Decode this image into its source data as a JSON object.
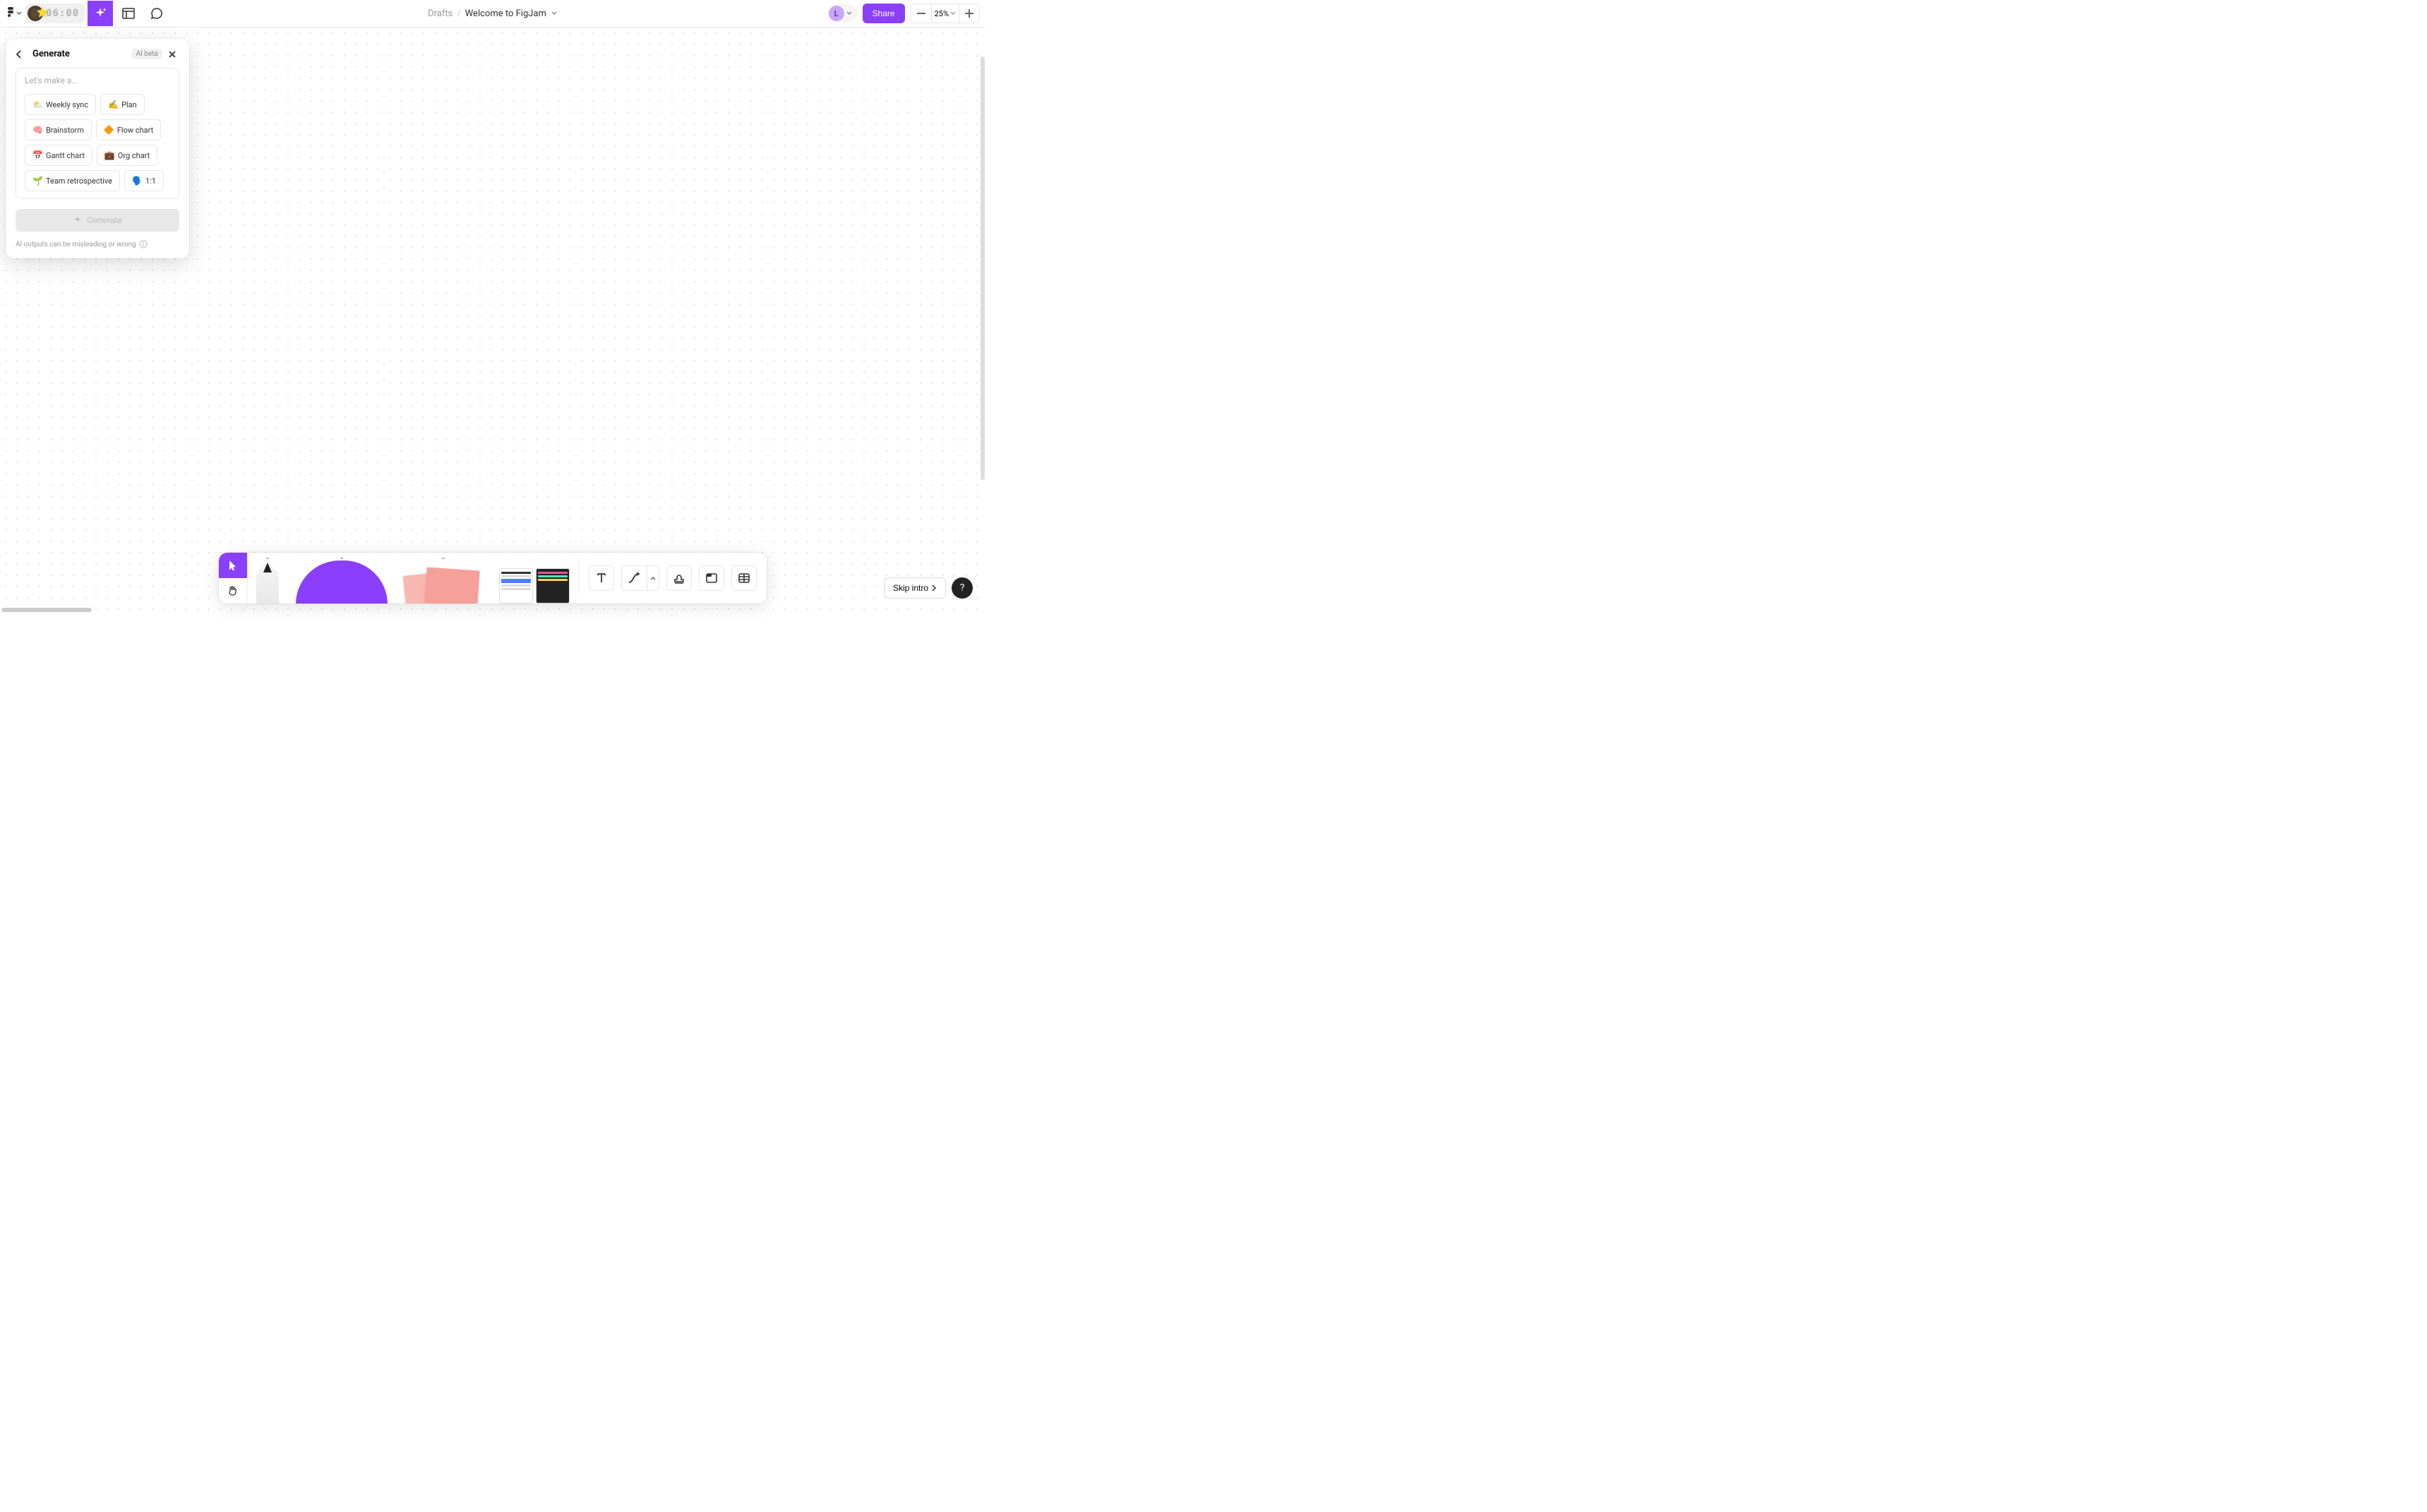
{
  "header": {
    "timer": "06:00",
    "breadcrumb": {
      "drafts": "Drafts",
      "title": "Welcome to FigJam"
    },
    "avatar_initial": "L",
    "share_label": "Share",
    "zoom": "25%"
  },
  "generate_panel": {
    "title": "Generate",
    "badge": "AI beta",
    "placeholder": "Let's make a...",
    "chips": [
      {
        "emoji": "⛅",
        "label": "Weekly sync"
      },
      {
        "emoji": "✍️",
        "label": "Plan"
      },
      {
        "emoji": "🧠",
        "label": "Brainstorm"
      },
      {
        "emoji": "🔶",
        "label": "Flow chart"
      },
      {
        "emoji": "📅",
        "label": "Gantt chart"
      },
      {
        "emoji": "💼",
        "label": "Org chart"
      },
      {
        "emoji": "🌱",
        "label": "Team retrospective"
      },
      {
        "emoji": "🗣️",
        "label": "1:1"
      }
    ],
    "submit_label": "Generate",
    "footer": "AI outputs can be misleading or wrong"
  },
  "skip_intro": "Skip intro",
  "help": "?"
}
